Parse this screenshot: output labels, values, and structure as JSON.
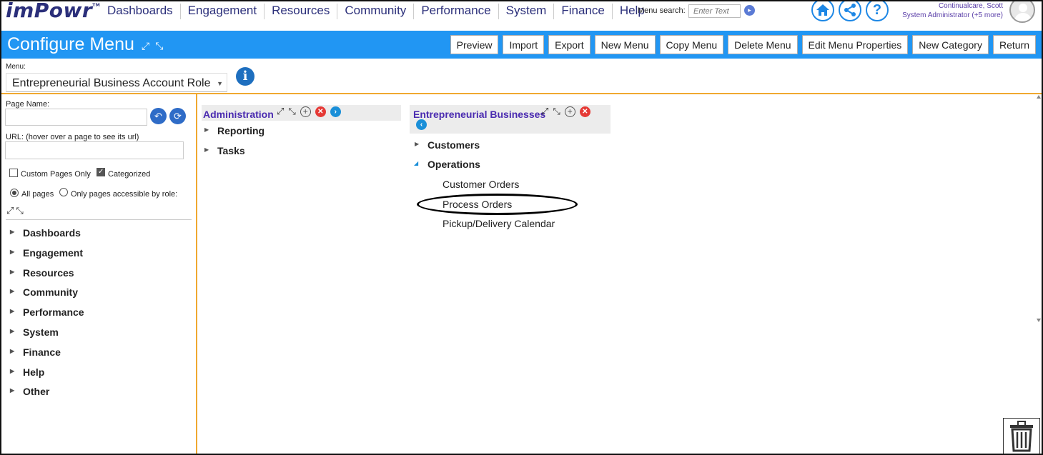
{
  "app": {
    "logo": "imPowr",
    "logo_tm": "TM"
  },
  "nav": {
    "items": [
      "Dashboards",
      "Engagement",
      "Resources",
      "Community",
      "Performance",
      "System",
      "Finance",
      "Help"
    ],
    "search_label": "Menu search:",
    "search_placeholder": "Enter Text"
  },
  "user": {
    "name": "Continualcare, Scott",
    "role": "System Administrator (+5 more)"
  },
  "header": {
    "title": "Configure Menu",
    "buttons": [
      "Preview",
      "Import",
      "Export",
      "New Menu",
      "Copy Menu",
      "Delete Menu",
      "Edit Menu Properties",
      "New Category",
      "Return"
    ]
  },
  "menu_select": {
    "label": "Menu:",
    "value": "Entrepreneurial Business Account Role"
  },
  "left_panel": {
    "page_name_label": "Page Name:",
    "url_label": "URL: (hover over a page to see its url)",
    "custom_pages_label": "Custom Pages Only",
    "custom_pages_checked": false,
    "categorized_label": "Categorized",
    "categorized_checked": true,
    "all_pages_label": "All pages",
    "role_pages_label": "Only pages accessible by role:",
    "selected_radio": "all",
    "tree": [
      "Dashboards",
      "Engagement",
      "Resources",
      "Community",
      "Performance",
      "System",
      "Finance",
      "Help",
      "Other"
    ]
  },
  "admin_panel": {
    "title": "Administration",
    "items": [
      "Reporting",
      "Tasks"
    ]
  },
  "entrepreneur_panel": {
    "title": "Entrepreneurial Businesses",
    "categories": [
      {
        "label": "Customers",
        "expanded": false
      },
      {
        "label": "Operations",
        "expanded": true
      }
    ],
    "pages": [
      "Customer Orders",
      "Process Orders",
      "Pickup/Delivery Calendar"
    ],
    "highlighted_page": "Process Orders"
  },
  "colors": {
    "brand": "#2b2f7a",
    "header_bar": "#2196f3",
    "divider": "#f0a830",
    "title_purple": "#4a2bb0"
  },
  "icons": [
    "home-icon",
    "share-icon",
    "help-icon",
    "info-icon",
    "expand-icon",
    "collapse-icon",
    "add-icon",
    "delete-icon",
    "next-icon",
    "back-icon",
    "undo-icon",
    "refresh-icon",
    "trash-icon"
  ]
}
